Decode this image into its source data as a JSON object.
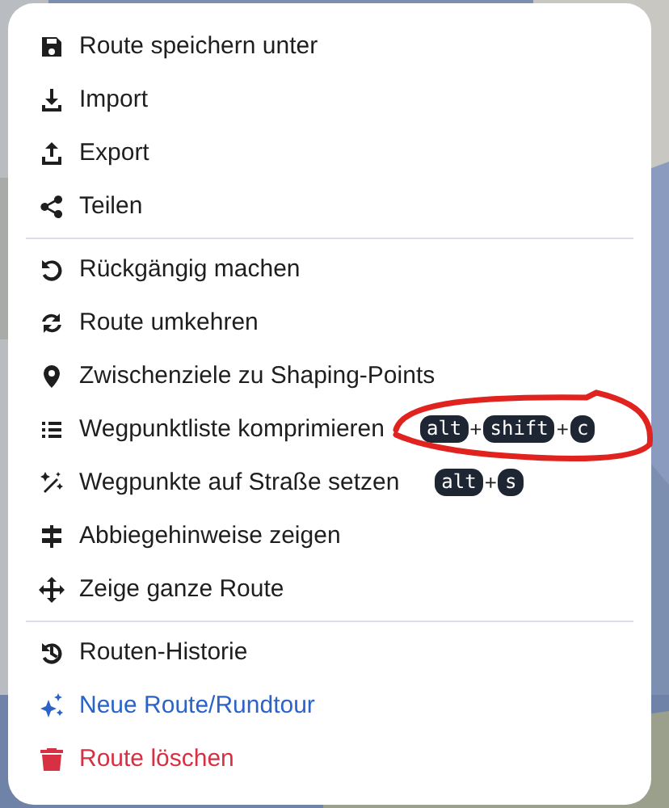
{
  "menu": {
    "groups": [
      {
        "items": [
          {
            "label": "Route speichern unter",
            "kind": "normal"
          },
          {
            "label": "Import",
            "kind": "normal"
          },
          {
            "label": "Export",
            "kind": "normal"
          },
          {
            "label": "Teilen",
            "kind": "normal"
          }
        ]
      },
      {
        "items": [
          {
            "label": "Rückgängig machen",
            "kind": "normal"
          },
          {
            "label": "Route umkehren",
            "kind": "normal"
          },
          {
            "label": "Zwischenziele zu Shaping-Points",
            "kind": "normal"
          },
          {
            "label": "Wegpunktliste komprimieren",
            "kind": "normal",
            "circled": true,
            "shortcut": {
              "keys": [
                "alt",
                "shift",
                "c"
              ],
              "separator": "+"
            }
          },
          {
            "label": "Wegpunkte auf Straße setzen",
            "kind": "normal",
            "circled": false,
            "shortcut": {
              "keys": [
                "alt",
                "s"
              ],
              "separator": "+"
            }
          },
          {
            "label": "Abbiegehinweise zeigen",
            "kind": "normal"
          },
          {
            "label": "Zeige ganze Route",
            "kind": "normal"
          }
        ]
      },
      {
        "items": [
          {
            "label": "Routen-Historie",
            "kind": "normal"
          },
          {
            "label": "Neue Route/Rundtour",
            "kind": "accent"
          },
          {
            "label": "Route löschen",
            "kind": "danger"
          }
        ]
      }
    ]
  }
}
